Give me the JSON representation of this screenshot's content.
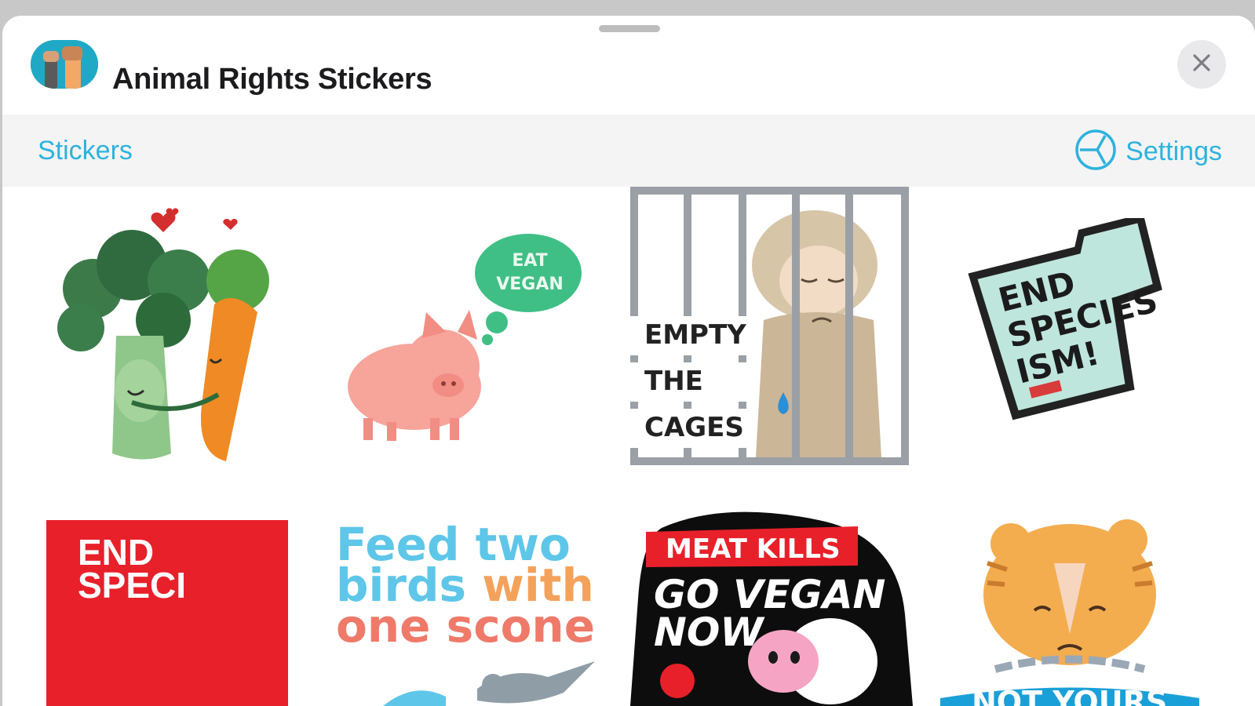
{
  "header": {
    "app_name": "Animal Rights Stickers",
    "app_icon": "fist-raised-icon",
    "close_icon": "close-icon"
  },
  "tabs": {
    "stickers_label": "Stickers",
    "settings_label": "Settings",
    "settings_icon": "settings-icon"
  },
  "stickers": [
    {
      "name": "broccoli-carrot-hug",
      "text": ""
    },
    {
      "name": "pig-eat-vegan",
      "line1": "EAT",
      "line2": "VEGAN"
    },
    {
      "name": "empty-the-cages",
      "line1": "EMPTY",
      "line2": "THE",
      "line3": "CAGES"
    },
    {
      "name": "end-speciesism",
      "line1": "END",
      "line2": "SPECIES",
      "line3": "ISM!"
    },
    {
      "name": "end-speci-red",
      "line1": "END",
      "line2": "SPECI"
    },
    {
      "name": "feed-two-birds",
      "line1a": "Feed",
      "line1b": "two",
      "line2a": "birds",
      "line2b": "with",
      "line3": "one scone"
    },
    {
      "name": "meat-kills",
      "line1": "MEAT KILLS",
      "line2": "GO VEGAN",
      "line3": "NOW"
    },
    {
      "name": "tiger-not-yours",
      "line1": "NOT YOURS"
    }
  ],
  "colors": {
    "accent": "#2fb2dd",
    "red": "#e8202a"
  }
}
